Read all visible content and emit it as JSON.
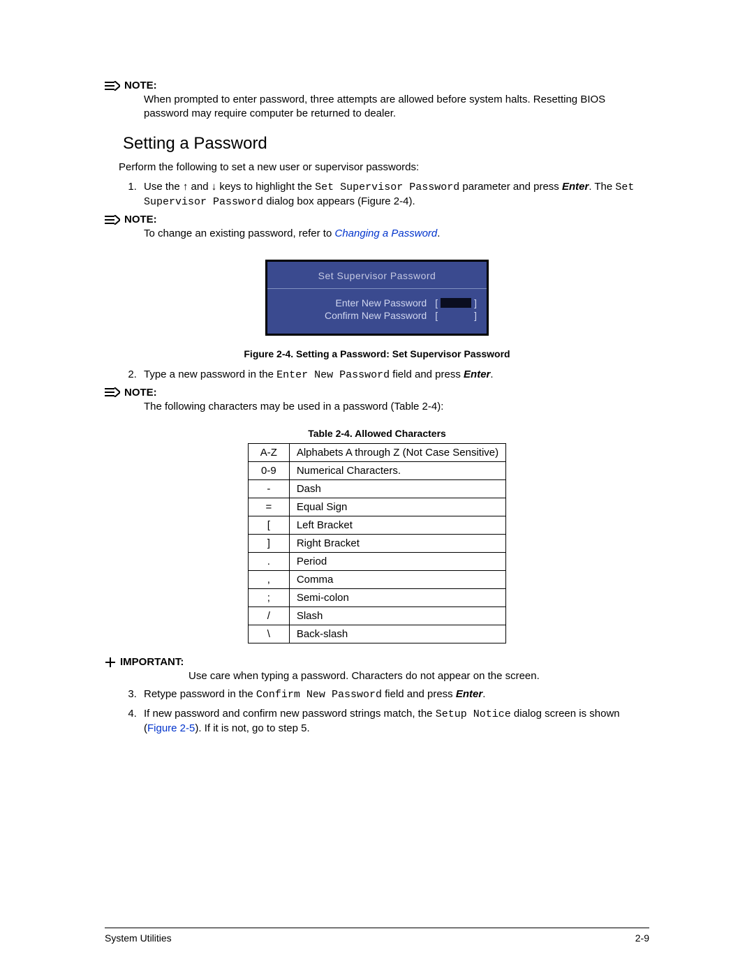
{
  "notes": {
    "label": "NOTE:",
    "note1": "When prompted to enter password, three attempts are allowed before system halts. Resetting BIOS password may require computer be returned to dealer.",
    "note2_prefix": "To change an existing password, refer to ",
    "note2_link": "Changing a Password",
    "note2_suffix": ".",
    "note3": "The following characters may be used in a password (Table 2-4):"
  },
  "heading": "Setting a Password",
  "intro": "Perform the following to set a new user or supervisor passwords:",
  "steps": {
    "s1_a": "Use the ",
    "s1_b": " and ",
    "s1_c": " keys to highlight the ",
    "s1_code1": "Set Supervisor Password",
    "s1_d": " parameter and press ",
    "s1_enter": "Enter",
    "s1_e": ". The ",
    "s1_code2": "Set Supervisor Password",
    "s1_f": " dialog box appears (Figure 2-4).",
    "s2_a": "Type a new password in the ",
    "s2_code": "Enter New Password",
    "s2_b": " field and press ",
    "s2_enter": "Enter",
    "s2_c": ".",
    "s3_a": "Retype password in the ",
    "s3_code": "Confirm New Password",
    "s3_b": " field and press ",
    "s3_enter": "Enter",
    "s3_c": ".",
    "s4_a": "If new password and confirm new password strings match, the ",
    "s4_code": "Setup Notice",
    "s4_b": " dialog screen is shown (",
    "s4_link": "Figure 2-5",
    "s4_c": "). If it is not, go to step 5."
  },
  "bios": {
    "title": "Set Supervisor Password",
    "row1": "Enter New Password",
    "row2": "Confirm New Password"
  },
  "figure_caption": "Figure 2-4.   Setting a Password: Set Supervisor Password",
  "table_caption": "Table 2-4.   Allowed Characters",
  "table_rows": [
    {
      "sym": "A-Z",
      "desc": "Alphabets A through Z (Not Case Sensitive)"
    },
    {
      "sym": "0-9",
      "desc": "Numerical Characters."
    },
    {
      "sym": "-",
      "desc": "Dash"
    },
    {
      "sym": "=",
      "desc": "Equal Sign"
    },
    {
      "sym": "[",
      "desc": "Left Bracket"
    },
    {
      "sym": "]",
      "desc": "Right Bracket"
    },
    {
      "sym": ".",
      "desc": "Period"
    },
    {
      "sym": ",",
      "desc": "Comma"
    },
    {
      "sym": ";",
      "desc": "Semi-colon"
    },
    {
      "sym": "/",
      "desc": "Slash"
    },
    {
      "sym": "\\",
      "desc": "Back-slash"
    }
  ],
  "important": {
    "label": "IMPORTANT:",
    "body": "Use care when typing a password. Characters do not appear on the screen."
  },
  "footer": {
    "left": "System Utilities",
    "right": "2-9"
  }
}
